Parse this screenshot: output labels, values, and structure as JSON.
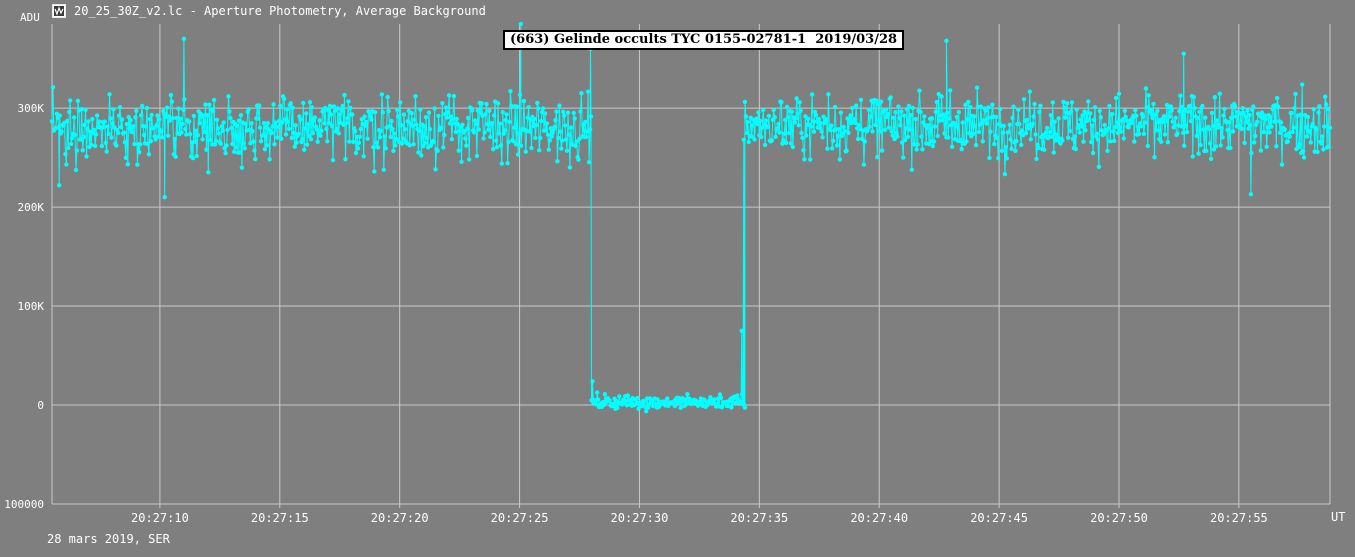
{
  "window": {
    "title": "20_25_30Z_v2.lc - Aperture Photometry, Average Background",
    "icon": "lightcurve-app-icon"
  },
  "footer": {
    "text": "28 mars 2019, SER"
  },
  "colors": {
    "background": "#7f7f7f",
    "grid": "#c8c8c8",
    "series": "#00ffff",
    "text": "#ffffff"
  },
  "chart_data": {
    "type": "line",
    "title": "(663) Gelinde occults TYC 0155-02781-1  2019/03/28",
    "ylabel": "ADU",
    "xlabel": "UT",
    "ylim": [
      -100000,
      385000
    ],
    "xlim": [
      "20:27:05.5",
      "20:27:58.8"
    ],
    "y_ticks": [
      {
        "value": -100000,
        "label": "100000"
      },
      {
        "value": 0,
        "label": "0"
      },
      {
        "value": 100000,
        "label": "100K"
      },
      {
        "value": 200000,
        "label": "200K"
      },
      {
        "value": 300000,
        "label": "300K"
      }
    ],
    "x_ticks": [
      "20:27:10",
      "20:27:15",
      "20:27:20",
      "20:27:25",
      "20:27:30",
      "20:27:35",
      "20:27:40",
      "20:27:45",
      "20:27:50",
      "20:27:55"
    ],
    "grid": true,
    "markers": true,
    "series": [
      {
        "color": "#00ffff",
        "sampling_interval_s": 0.04,
        "segments": [
          {
            "start": "20:27:05.5",
            "end": "20:27:28.0",
            "mean": 280000,
            "noise_sd": 22000,
            "min": 210000,
            "max": 385000
          },
          {
            "start": "20:27:28.0",
            "end": "20:27:34.4",
            "mean": 3000,
            "noise_sd": 5000,
            "min": -15000,
            "max": 25000
          },
          {
            "start": "20:27:34.4",
            "end": "20:27:58.8",
            "mean": 283000,
            "noise_sd": 22000,
            "min": 213000,
            "max": 368000
          }
        ],
        "highlighted_points": [
          {
            "x": "20:27:25.05",
            "y": 385000
          },
          {
            "x": "20:27:27.96",
            "y": 360000
          },
          {
            "x": "20:27:28.04",
            "y": 24000
          },
          {
            "x": "20:27:34.27",
            "y": 75000
          },
          {
            "x": "20:27:34.35",
            "y": 268000
          },
          {
            "x": "20:27:11.0",
            "y": 370000
          },
          {
            "x": "20:27:05.8",
            "y": 222000
          },
          {
            "x": "20:27:10.2",
            "y": 210000
          },
          {
            "x": "20:27:42.8",
            "y": 368000
          },
          {
            "x": "20:27:52.7",
            "y": 355000
          },
          {
            "x": "20:27:55.5",
            "y": 213000
          }
        ]
      }
    ]
  }
}
